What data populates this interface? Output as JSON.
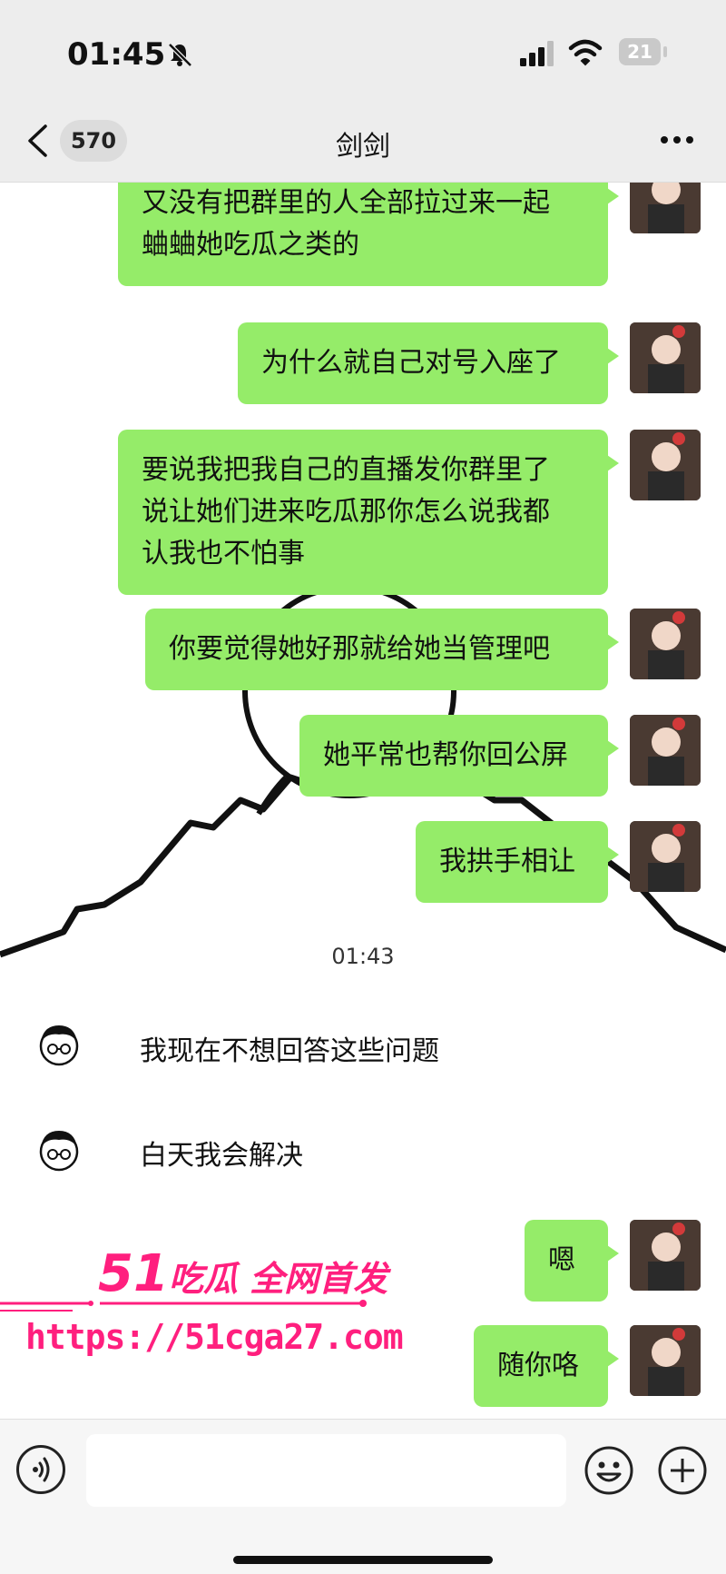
{
  "status_bar": {
    "time": "01:45",
    "battery": "21"
  },
  "header": {
    "unread_count": "570",
    "title": "剑剑"
  },
  "messages": [
    {
      "side": "me",
      "lines": [
        "又没有把群里的人全部拉过来一起",
        "蛐蛐她吃瓜之类的"
      ]
    },
    {
      "side": "me",
      "lines": [
        "为什么就自己对号入座了"
      ]
    },
    {
      "side": "me",
      "lines": [
        "要说我把我自己的直播发你群里了",
        "说让她们进来吃瓜那你怎么说我都",
        "认我也不怕事"
      ]
    },
    {
      "side": "me",
      "lines": [
        "你要觉得她好那就给她当管理吧"
      ]
    },
    {
      "side": "me",
      "lines": [
        "她平常也帮你回公屏"
      ]
    },
    {
      "side": "me",
      "lines": [
        "我拱手相让"
      ]
    },
    {
      "side": "other",
      "lines": [
        "我现在不想回答这些问题"
      ]
    },
    {
      "side": "other",
      "lines": [
        "白天我会解决"
      ]
    },
    {
      "side": "me",
      "lines": [
        "嗯"
      ]
    },
    {
      "side": "me",
      "lines": [
        "随你咯"
      ]
    }
  ],
  "timestamp": "01:43",
  "watermark": {
    "title_big": "51",
    "title_rest": "吃瓜 全网首发",
    "url": "https://51cga27.com"
  },
  "icons": [
    "bell-muted-icon",
    "signal-icon",
    "wifi-icon",
    "back-chevron-icon",
    "more-dots-icon",
    "voice-icon",
    "emoji-icon",
    "plus-icon"
  ],
  "colors": {
    "bubble_me": "#95ec69",
    "watermark": "#ff1f7e",
    "bar_bg": "#ededed"
  }
}
